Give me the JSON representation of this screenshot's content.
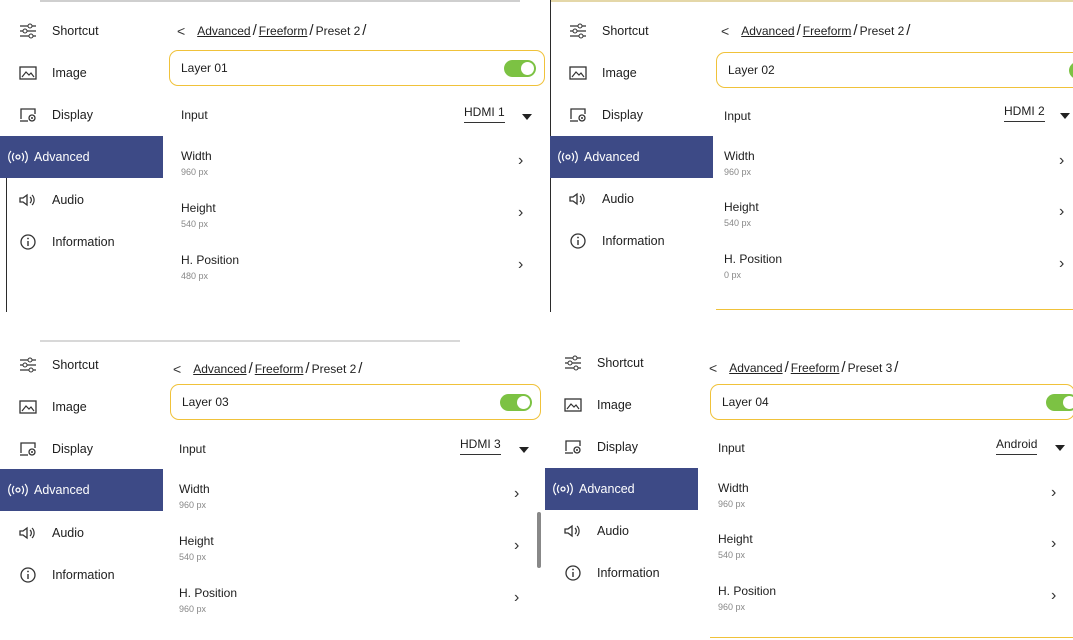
{
  "sidebar": {
    "items": [
      {
        "label": "Shortcut",
        "icon": "sliders-icon"
      },
      {
        "label": "Image",
        "icon": "image-icon"
      },
      {
        "label": "Display",
        "icon": "display-settings-icon"
      },
      {
        "label": "Advanced",
        "icon": "broadcast-icon"
      },
      {
        "label": "Audio",
        "icon": "speaker-icon"
      },
      {
        "label": "Information",
        "icon": "info-icon"
      }
    ]
  },
  "colors": {
    "active_bg": "#3d4a86",
    "highlight_border": "#f0c23a",
    "toggle_on": "#7cc243"
  },
  "panels": [
    {
      "breadcrumb": {
        "back": "<",
        "items": [
          "Advanced",
          "Freeform",
          "Preset 2"
        ],
        "sep": "/"
      },
      "layer": {
        "label": "Layer 01",
        "enabled": true
      },
      "input": {
        "label": "Input",
        "value": "HDMI 1"
      },
      "width": {
        "label": "Width",
        "value": "960 px"
      },
      "height": {
        "label": "Height",
        "value": "540 px"
      },
      "hpos": {
        "label": "H. Position",
        "value": "480 px"
      }
    },
    {
      "breadcrumb": {
        "back": "<",
        "items": [
          "Advanced",
          "Freeform",
          "Preset 2"
        ],
        "sep": "/"
      },
      "layer": {
        "label": "Layer 02",
        "enabled": true
      },
      "input": {
        "label": "Input",
        "value": "HDMI 2"
      },
      "width": {
        "label": "Width",
        "value": "960 px"
      },
      "height": {
        "label": "Height",
        "value": "540 px"
      },
      "hpos": {
        "label": "H. Position",
        "value": "0 px"
      }
    },
    {
      "breadcrumb": {
        "back": "<",
        "items": [
          "Advanced",
          "Freeform",
          "Preset 2"
        ],
        "sep": "/"
      },
      "layer": {
        "label": "Layer 03",
        "enabled": true
      },
      "input": {
        "label": "Input",
        "value": "HDMI 3"
      },
      "width": {
        "label": "Width",
        "value": "960 px"
      },
      "height": {
        "label": "Height",
        "value": "540 px"
      },
      "hpos": {
        "label": "H. Position",
        "value": "960 px"
      }
    },
    {
      "breadcrumb": {
        "back": "<",
        "items": [
          "Advanced",
          "Freeform",
          "Preset 3"
        ],
        "sep": "/"
      },
      "layer": {
        "label": "Layer 04",
        "enabled": true
      },
      "input": {
        "label": "Input",
        "value": "Android"
      },
      "width": {
        "label": "Width",
        "value": "960 px"
      },
      "height": {
        "label": "Height",
        "value": "540 px"
      },
      "hpos": {
        "label": "H. Position",
        "value": "960 px"
      }
    }
  ]
}
